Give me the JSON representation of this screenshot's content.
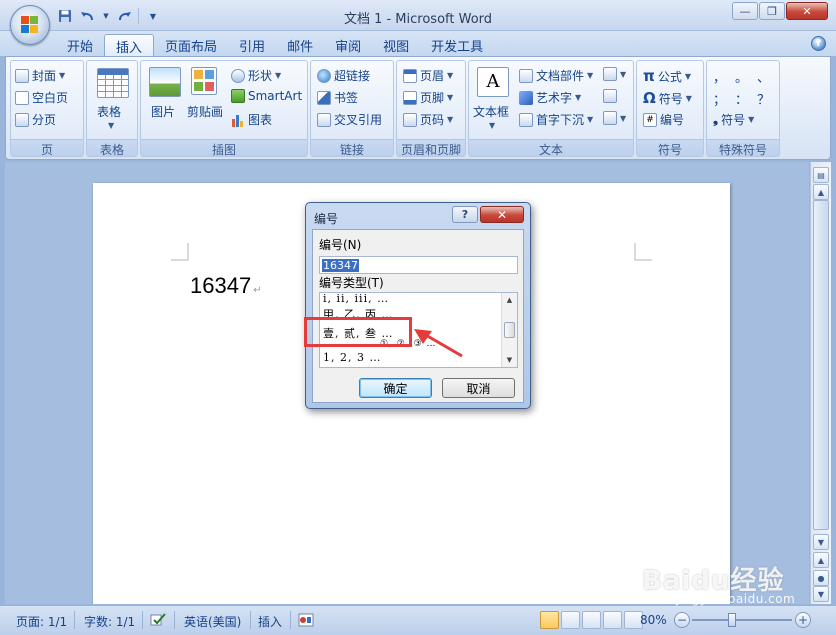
{
  "window": {
    "title": "文档 1 - Microsoft Word",
    "minimize_glyph": "—",
    "restore_glyph": "❐",
    "close_glyph": "✕"
  },
  "tabs": [
    "开始",
    "插入",
    "页面布局",
    "引用",
    "邮件",
    "审阅",
    "视图",
    "开发工具"
  ],
  "active_tab": "插入",
  "ribbon": {
    "page": {
      "label": "页",
      "items": [
        "封面",
        "空白页",
        "分页"
      ]
    },
    "table": {
      "label": "表格",
      "button": "表格"
    },
    "illustrations": {
      "label": "插图",
      "picture": "图片",
      "clipart": "剪贴画",
      "shapes": "形状",
      "smartart": "SmartArt",
      "chart": "图表"
    },
    "links": {
      "label": "链接",
      "hyperlink": "超链接",
      "bookmark": "书签",
      "crossref": "交叉引用"
    },
    "header_footer": {
      "label": "页眉和页脚",
      "header": "页眉",
      "footer": "页脚",
      "page_number": "页码"
    },
    "text": {
      "label": "文本",
      "textbox": "文本框",
      "quickparts": "文档部件",
      "wordart": "艺术字",
      "dropcap": "首字下沉"
    },
    "symbols": {
      "label": "符号",
      "equation": "公式",
      "symbol": "符号",
      "numbering": "编号"
    },
    "special": {
      "label": "特殊符号",
      "symbol": "符号",
      "glyphs": [
        "，",
        "。",
        "、",
        "；",
        "：",
        "？"
      ]
    }
  },
  "document": {
    "text": "16347",
    "para_mark": "↵"
  },
  "dialog": {
    "title": "编号",
    "help_glyph": "?",
    "close_glyph": "✕",
    "number_label": "编号(N)",
    "number_value": "16347",
    "type_label": "编号类型(T)",
    "types": [
      "i, ii, iii, …",
      "甲, 乙, 丙 …",
      "壹, 贰, 叁 …",
      "①, ②, ③ …",
      "1, 2, 3 …"
    ],
    "ok": "确定",
    "cancel": "取消"
  },
  "statusbar": {
    "page": "页面: 1/1",
    "words": "字数: 1/1",
    "language": "英语(美国)",
    "mode": "插入",
    "zoom": "80%"
  },
  "watermark": {
    "main": "Baidu经验",
    "sub": "jingyan.baidu.com"
  },
  "colors": {
    "highlight": "#e53b3b",
    "accent": "#15428b"
  }
}
